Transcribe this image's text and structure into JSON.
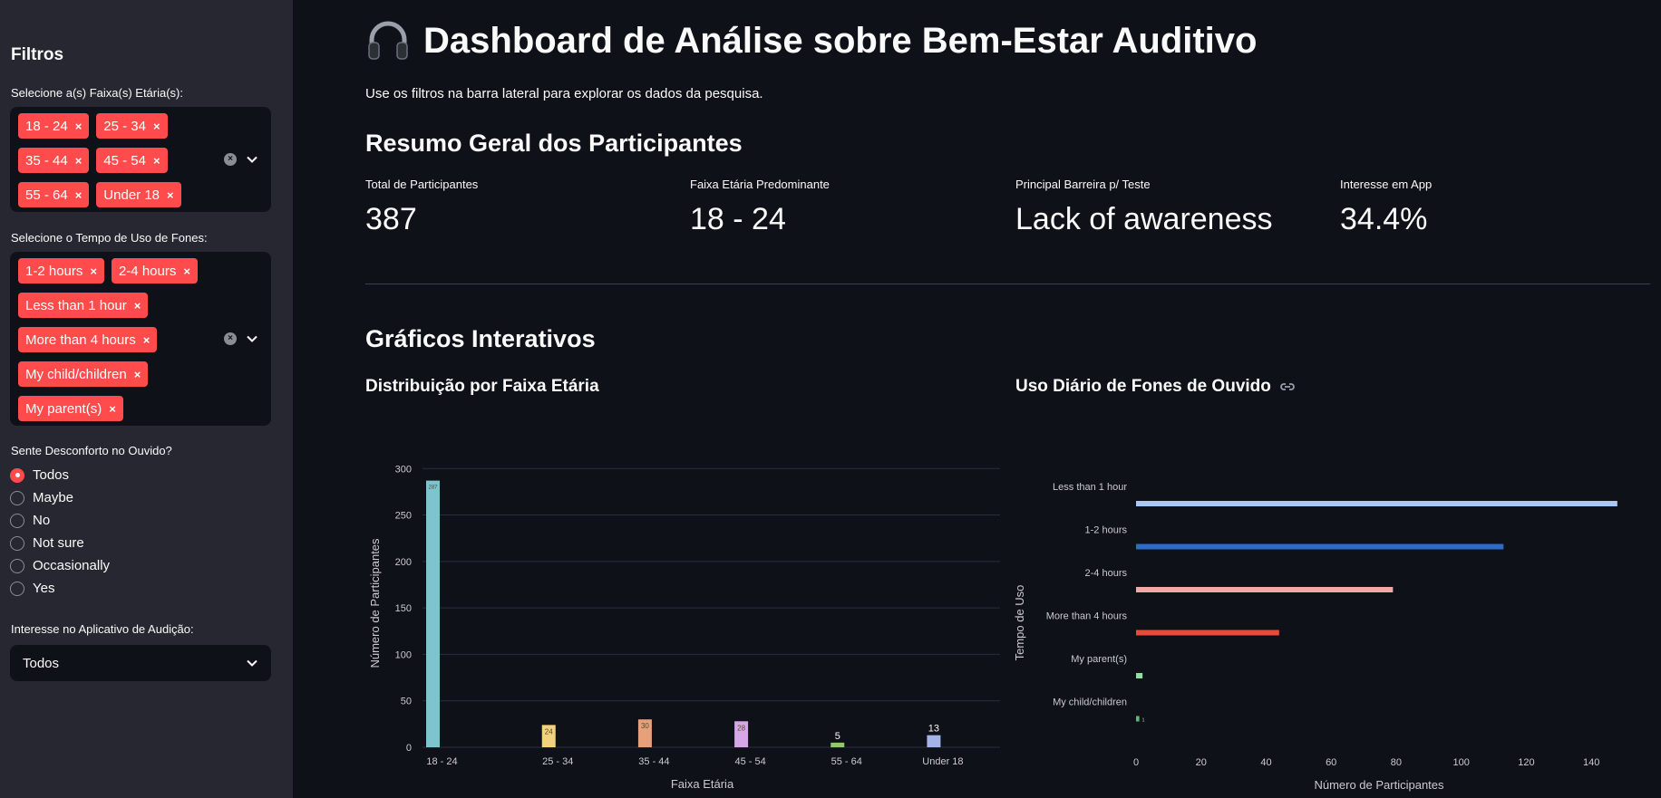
{
  "sidebar": {
    "title": "Filtros",
    "age_label": "Selecione a(s) Faixa(s) Etária(s):",
    "age_chips": [
      "18 - 24",
      "25 - 34",
      "35 - 44",
      "45 - 54",
      "55 - 64",
      "Under 18"
    ],
    "usage_label": "Selecione o Tempo de Uso de Fones:",
    "usage_chips": [
      "1-2 hours",
      "2-4 hours",
      "Less than 1 hour",
      "More than 4 hours",
      "My child/children",
      "My parent(s)"
    ],
    "discomfort_label": "Sente Desconforto no Ouvido?",
    "discomfort_options": [
      "Todos",
      "Maybe",
      "No",
      "Not sure",
      "Occasionally",
      "Yes"
    ],
    "discomfort_selected": "Todos",
    "interest_label": "Interesse no Aplicativo de Audição:",
    "interest_value": "Todos"
  },
  "header": {
    "title": "Dashboard de Análise sobre Bem-Estar Auditivo",
    "subtitle": "Use os filtros na barra lateral para explorar os dados da pesquisa."
  },
  "summary": {
    "heading": "Resumo Geral dos Participantes",
    "metrics": [
      {
        "label": "Total de Participantes",
        "value": "387"
      },
      {
        "label": "Faixa Etária Predominante",
        "value": "18 - 24"
      },
      {
        "label": "Principal Barreira p/ Teste",
        "value": "Lack of awareness"
      },
      {
        "label": "Interesse em App",
        "value": "34.4%"
      }
    ]
  },
  "charts_heading": "Gráficos Interativos",
  "chart_data": [
    {
      "type": "bar",
      "title": "Distribuição por Faixa Etária",
      "xlabel": "Faixa Etária",
      "ylabel": "Número de Participantes",
      "categories": [
        "18 - 24",
        "25 - 34",
        "35 - 44",
        "45 - 54",
        "55 - 64",
        "Under 18"
      ],
      "values": [
        287,
        24,
        30,
        28,
        5,
        13
      ],
      "value_labels": [
        "287",
        "24",
        "30",
        "28",
        "5",
        "13"
      ],
      "colors": [
        "#7ec4cf",
        "#f2d27a",
        "#e6a07c",
        "#d7a6e8",
        "#8fc96b",
        "#a4b3e8"
      ],
      "ylim": [
        0,
        310
      ],
      "yticks": [
        0,
        50,
        100,
        150,
        200,
        250,
        300
      ],
      "grid": true
    },
    {
      "type": "bar",
      "orientation": "horizontal",
      "title": "Uso Diário de Fones de Ouvido",
      "xlabel": "Número de Participantes",
      "ylabel": "Tempo de Uso",
      "categories": [
        "Less than 1 hour",
        "1-2 hours",
        "2-4 hours",
        "More than 4 hours",
        "My parent(s)",
        "My child/children"
      ],
      "values": [
        148,
        113,
        79,
        44,
        2,
        1
      ],
      "value_labels": [
        "",
        "",
        "",
        "",
        "",
        "1"
      ],
      "colors": [
        "#a7c8f5",
        "#2f6bc4",
        "#f5a6a6",
        "#e84b3c",
        "#8fe0a0",
        "#5fb87a"
      ],
      "xlim": [
        0,
        150
      ],
      "xticks": [
        0,
        20,
        40,
        60,
        80,
        100,
        120,
        140
      ],
      "grid": false
    }
  ]
}
